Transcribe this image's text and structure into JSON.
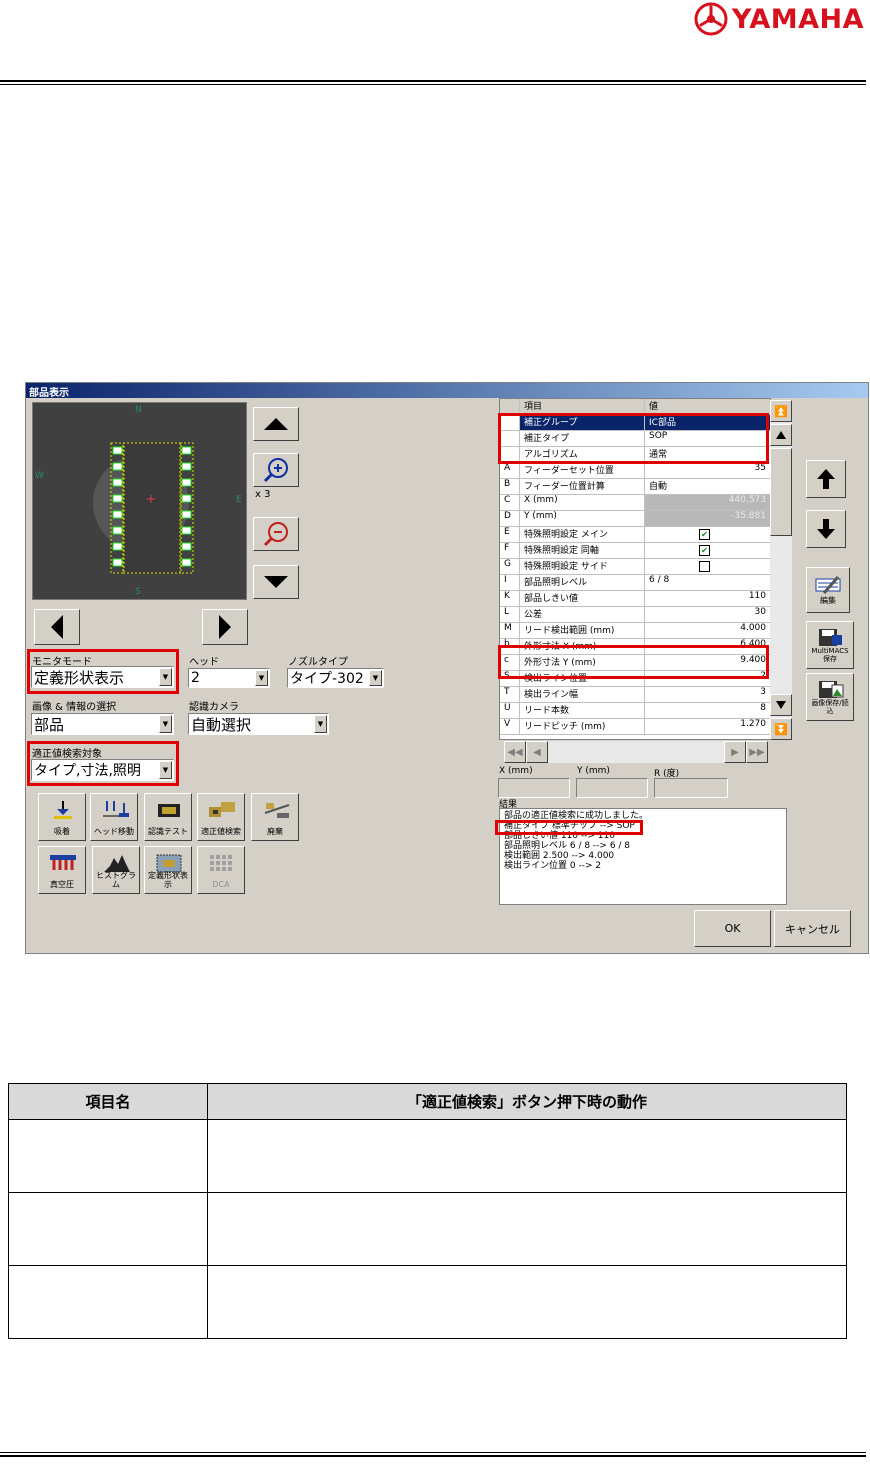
{
  "header": {
    "brand": "YAMAHA"
  },
  "window": {
    "title": "部品表示",
    "camera": {
      "north": "N",
      "south": "S",
      "west": "W",
      "east": "E",
      "zoom": "x 3"
    },
    "fields": {
      "monitor_mode": {
        "label": "モニタモード",
        "value": "定義形状表示"
      },
      "head": {
        "label": "ヘッド",
        "value": "2"
      },
      "nozzle_type": {
        "label": "ノズルタイプ",
        "value": "タイプ-302"
      },
      "image_info": {
        "label": "画像 & 情報の選択",
        "value": "部品"
      },
      "camera_sel": {
        "label": "認識カメラ",
        "value": "自動選択"
      },
      "search_target": {
        "label": "適正値検索対象",
        "value": "タイプ,寸法,照明"
      }
    },
    "toolbar": [
      {
        "label": "吸着"
      },
      {
        "label": "ヘッド移動"
      },
      {
        "label": "認識テスト"
      },
      {
        "label": "適正値検索"
      },
      {
        "label": "廃棄"
      },
      {
        "label": "真空圧"
      },
      {
        "label": "ヒストグラム"
      },
      {
        "label": "定義形状表示"
      },
      {
        "label": "DCA"
      }
    ],
    "grid": {
      "headers": {
        "item": "項目",
        "value": "値"
      },
      "rows": [
        {
          "k": "",
          "item": "補正グループ",
          "value": "IC部品",
          "selected": true
        },
        {
          "k": "",
          "item": "補正タイプ",
          "value": "SOP"
        },
        {
          "k": "",
          "item": "アルゴリズム",
          "value": "通常"
        },
        {
          "k": "A",
          "item": "フィーダーセット位置",
          "value": "35",
          "right": true
        },
        {
          "k": "B",
          "item": "フィーダー位置計算",
          "value": "自動"
        },
        {
          "k": "C",
          "item": "X (mm)",
          "value": "440.573",
          "gray": true,
          "right": true
        },
        {
          "k": "D",
          "item": "Y (mm)",
          "value": "-35.881",
          "gray": true,
          "right": true
        },
        {
          "k": "E",
          "item": "特殊照明設定 メイン",
          "value": "",
          "check": "on"
        },
        {
          "k": "F",
          "item": "特殊照明設定 同軸",
          "value": "",
          "check": "on"
        },
        {
          "k": "G",
          "item": "特殊照明設定 サイド",
          "value": "",
          "check": "off"
        },
        {
          "k": "I",
          "item": "部品照明レベル",
          "value": "6 / 8"
        },
        {
          "k": "K",
          "item": "部品しきい値",
          "value": "110",
          "right": true
        },
        {
          "k": "L",
          "item": "公差",
          "value": "30",
          "right": true
        },
        {
          "k": "M",
          "item": "リード検出範囲 (mm)",
          "value": "4.000",
          "right": true
        },
        {
          "k": "b",
          "item": "外形寸法 X (mm)",
          "value": "6.400",
          "right": true
        },
        {
          "k": "c",
          "item": "外形寸法 Y (mm)",
          "value": "9.400",
          "right": true
        },
        {
          "k": "S",
          "item": "検出ライン位置",
          "value": "2",
          "right": true
        },
        {
          "k": "T",
          "item": "検出ライン幅",
          "value": "3",
          "right": true
        },
        {
          "k": "U",
          "item": "リード本数",
          "value": "8",
          "right": true
        },
        {
          "k": "V",
          "item": "リードピッチ (mm)",
          "value": "1.270",
          "right": true
        }
      ]
    },
    "coords": {
      "x_label": "X (mm)",
      "y_label": "Y (mm)",
      "r_label": "R (度)"
    },
    "right_buttons": {
      "edit": "編集",
      "mmd": "MultiMACS保存",
      "img": "画像保存/読込"
    },
    "result": {
      "title": "結果",
      "lines": [
        "部品の適正値検索に成功しました。",
        "補正タイプ 標準チップ --> SOP",
        "部品しきい値 110 --> 110",
        "部品照明レベル 6 / 8 --> 6 / 8",
        "検出範囲 2.500 --> 4.000",
        "検出ライン位置 0 --> 2"
      ]
    },
    "ok_label": "OK",
    "cancel_label": "キャンセル"
  },
  "table": {
    "headers": {
      "col1": "項目名",
      "col2": "「適正値検索」ボタン押下時の動作"
    }
  }
}
